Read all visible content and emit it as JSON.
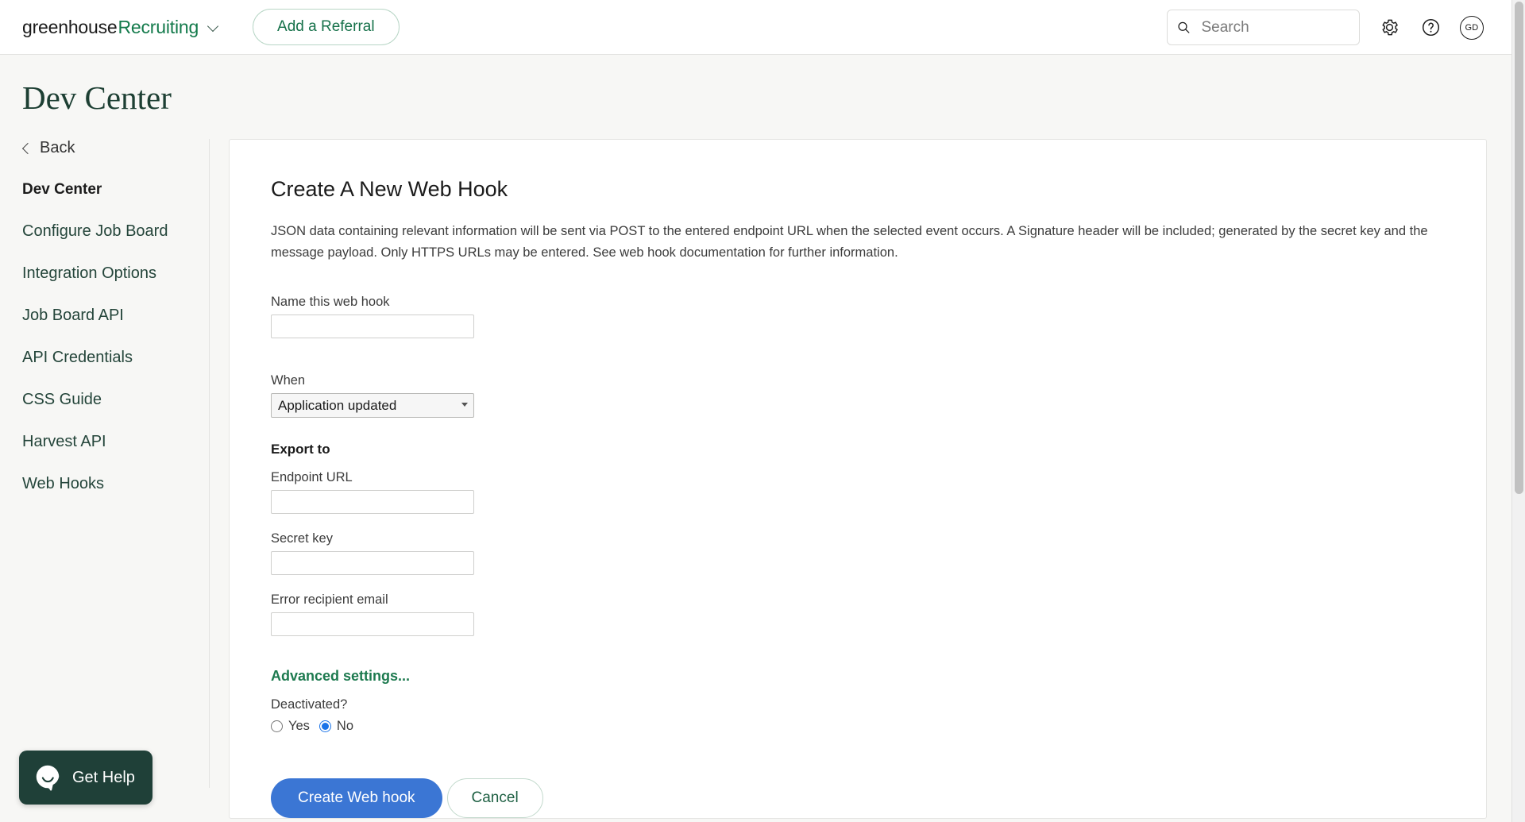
{
  "topnav": {
    "brand_first": "greenhouse",
    "brand_second": "Recruiting",
    "referral_button": "Add a Referral",
    "search_placeholder": "Search",
    "search_value": "",
    "avatar_initials": "GD",
    "icons": {
      "caret": "chevron-down-icon",
      "search": "search-icon",
      "settings": "gear-icon",
      "help": "question-circle-icon"
    }
  },
  "page": {
    "title": "Dev Center"
  },
  "sidebar": {
    "back_label": "Back",
    "items": [
      {
        "label": "Dev Center",
        "active": true
      },
      {
        "label": "Configure Job Board",
        "active": false
      },
      {
        "label": "Integration Options",
        "active": false
      },
      {
        "label": "Job Board API",
        "active": false
      },
      {
        "label": "API Credentials",
        "active": false
      },
      {
        "label": "CSS Guide",
        "active": false
      },
      {
        "label": "Harvest API",
        "active": false
      },
      {
        "label": "Web Hooks",
        "active": false
      }
    ]
  },
  "main": {
    "heading": "Create A New Web Hook",
    "description": "JSON data containing relevant information will be sent via POST to the entered endpoint URL when the selected event occurs. A Signature header will be included; generated by the secret key and the message payload. Only HTTPS URLs may be entered. See web hook documentation for further information.",
    "name_label": "Name this web hook",
    "name_value": "",
    "when_label": "When",
    "when_selected": "Application updated",
    "when_options": [
      "Application updated"
    ],
    "export_section_title": "Export to",
    "endpoint_label": "Endpoint URL",
    "endpoint_value": "",
    "secret_label": "Secret key",
    "secret_value": "",
    "error_email_label": "Error recipient email",
    "error_email_value": "",
    "advanced_link": "Advanced settings...",
    "deactivated_label": "Deactivated?",
    "radio_yes": "Yes",
    "radio_no": "No",
    "radio_selected": "No",
    "submit_button": "Create Web hook",
    "cancel_button": "Cancel"
  },
  "widget": {
    "get_help_label": "Get Help",
    "icon": "chat-smiley-icon"
  },
  "colors": {
    "brand_green": "#137a4b",
    "dark_green": "#1f4038",
    "title_green": "#1d3f33",
    "primary_button_blue": "#3b76d4",
    "link_green": "#1d7a4f"
  }
}
